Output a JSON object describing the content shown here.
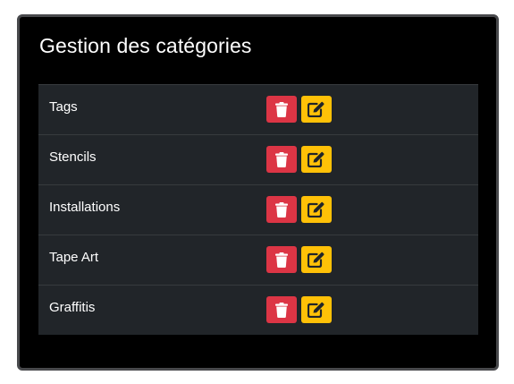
{
  "panel": {
    "title": "Gestion des catégories"
  },
  "categories": [
    {
      "name": "Tags"
    },
    {
      "name": "Stencils"
    },
    {
      "name": "Installations"
    },
    {
      "name": "Tape Art"
    },
    {
      "name": "Graffitis"
    }
  ],
  "icons": {
    "delete": "trash-icon",
    "edit": "edit-icon"
  },
  "colors": {
    "delete_button": "#dc3545",
    "edit_button": "#ffc107",
    "table_background": "#212529",
    "panel_background": "#000000"
  }
}
